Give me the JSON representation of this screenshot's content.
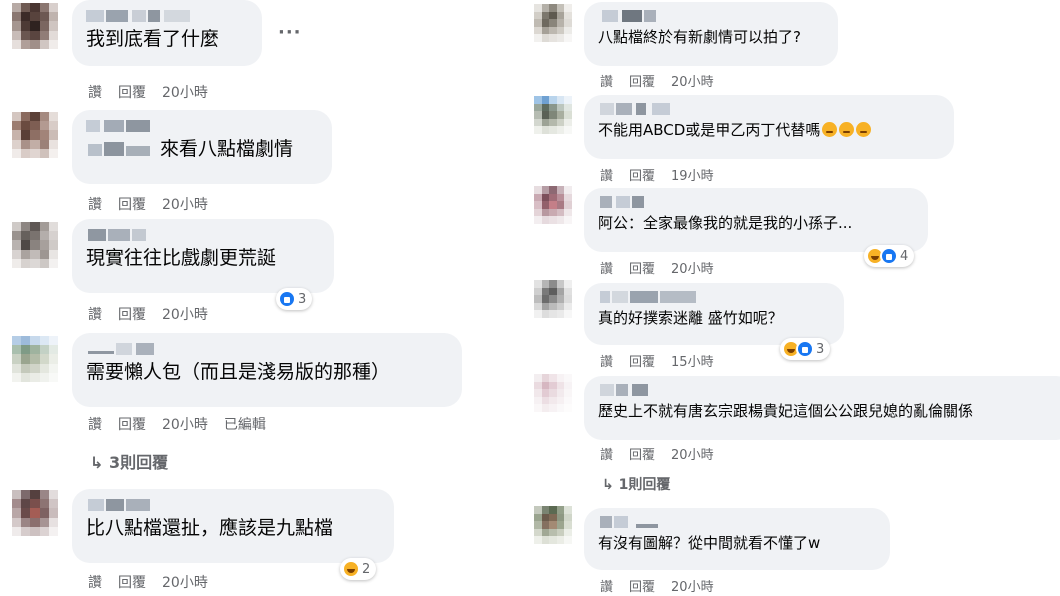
{
  "actions": {
    "like": "讚",
    "reply": "回覆",
    "edited": "已編輯"
  },
  "left_comments": [
    {
      "text": "我到底看了什麼",
      "time": "20小時"
    },
    {
      "text": "來看八點檔劇情",
      "time": "20小時"
    },
    {
      "text": "現實往往比戲劇更荒誕",
      "time": "20小時",
      "reaction_count": "3"
    },
    {
      "text": "需要懶人包（而且是淺易版的那種）",
      "time": "20小時",
      "replies": "↳ 3則回覆"
    },
    {
      "text": "比八點檔還扯，應該是九點檔",
      "time": "20小時",
      "reaction_count": "2"
    }
  ],
  "right_comments": [
    {
      "text": "八點檔終於有新劇情可以拍了?",
      "time": "20小時"
    },
    {
      "text": "不能用ABCD或是甲乙丙丁代替嗎",
      "time": "19小時"
    },
    {
      "text": "阿公：全家最像我的就是我的小孫子...",
      "time": "20小時",
      "reaction_count": "4"
    },
    {
      "text": "真的好撲索迷離 盛竹如呢？",
      "time": "15小時",
      "reaction_count": "3"
    },
    {
      "text": "歷史上不就有唐玄宗跟楊貴妃這個公公跟兒媳的亂倫關係",
      "time": "20小時",
      "replies": "↳ 1則回覆"
    },
    {
      "text": "有沒有圖解？從中間就看不懂了w",
      "time": "20小時"
    }
  ],
  "more_label": "···",
  "colors": {
    "bubble": "#f0f2f5",
    "meta_text": "#65676b",
    "like_blue": "#1877f2",
    "haha_yellow": "#f7b125"
  },
  "icons": [
    "like-reaction-icon",
    "haha-reaction-icon",
    "reply-arrow-icon",
    "more-options-icon",
    "worried-face-emoji"
  ]
}
